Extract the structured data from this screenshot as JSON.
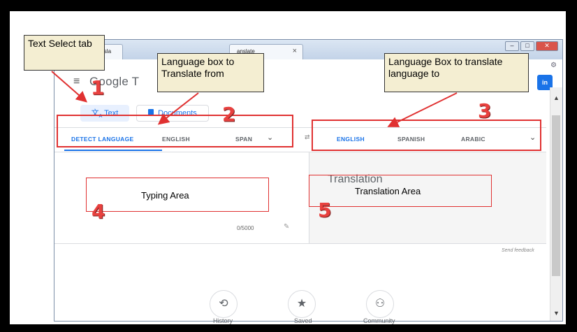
{
  "browser": {
    "tabs": [
      {
        "title": "https://transla"
      },
      {
        "title": "anslate"
      }
    ],
    "controls": {
      "minimize": "–",
      "maximize": "□",
      "close": "✕",
      "tab_close": "×"
    }
  },
  "page": {
    "menu_icon": "menu-icon",
    "logo": "Google T",
    "signin_label": "in",
    "mode_tabs": {
      "text": "Text",
      "documents": "Documents"
    },
    "source_languages": [
      "DETECT LANGUAGE",
      "ENGLISH",
      "SPAN"
    ],
    "target_languages": [
      "ENGLISH",
      "SPANISH",
      "ARABIC"
    ],
    "translation_placeholder": "Translation",
    "char_counter": "0/5000",
    "feedback": "Send feedback",
    "bottom_actions": [
      {
        "label": "History",
        "icon": "history-icon"
      },
      {
        "label": "Saved",
        "icon": "star-icon"
      },
      {
        "label": "Community",
        "icon": "community-icon"
      }
    ]
  },
  "annotations": {
    "text_select_tab": "Text Select tab",
    "language_from": "Language box to Translate from",
    "language_to": "Language Box to translate language to",
    "typing_area": "Typing Area",
    "translation_area": "Translation Area",
    "numbers": [
      "1",
      "2",
      "3",
      "4",
      "5"
    ]
  },
  "colors": {
    "accent": "#1a73e8",
    "annotation_red": "#e03131",
    "note_bg": "#f4eed2"
  }
}
